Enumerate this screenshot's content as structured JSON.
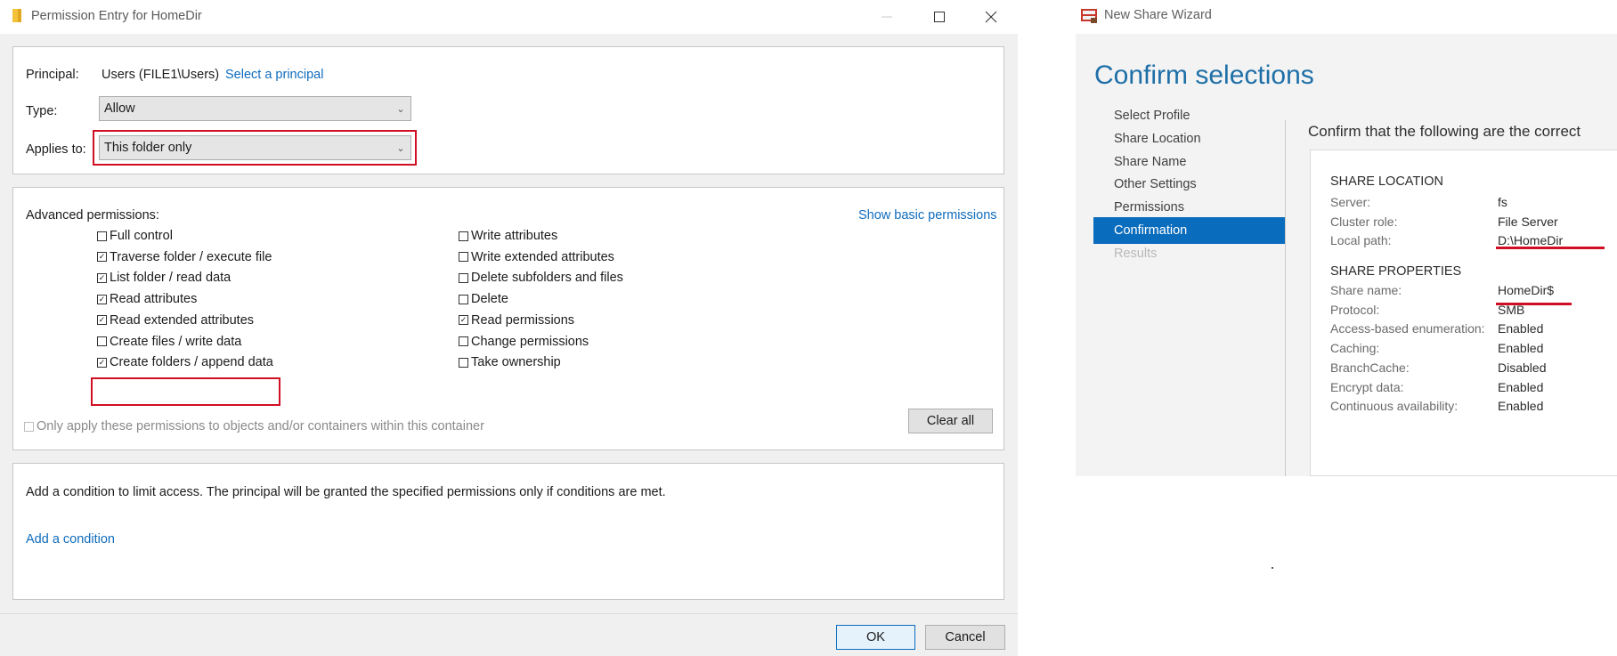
{
  "permission_entry": {
    "title": "Permission Entry for HomeDir",
    "principal": {
      "label": "Principal:",
      "value": "Users (FILE1\\Users)",
      "link": "Select a principal"
    },
    "type": {
      "label": "Type:",
      "value": "Allow"
    },
    "applies_to": {
      "label": "Applies to:",
      "value": "This folder only"
    },
    "advanced_label": "Advanced permissions:",
    "show_basic_link": "Show basic permissions",
    "permissions_left": [
      {
        "label": "Full control",
        "checked": false
      },
      {
        "label": "Traverse folder / execute file",
        "checked": true
      },
      {
        "label": "List folder / read data",
        "checked": true
      },
      {
        "label": "Read attributes",
        "checked": true
      },
      {
        "label": "Read extended attributes",
        "checked": true
      },
      {
        "label": "Create files / write data",
        "checked": false
      },
      {
        "label": "Create folders / append data",
        "checked": true
      }
    ],
    "permissions_right": [
      {
        "label": "Write attributes",
        "checked": false
      },
      {
        "label": "Write extended attributes",
        "checked": false
      },
      {
        "label": "Delete subfolders and files",
        "checked": false
      },
      {
        "label": "Delete",
        "checked": false
      },
      {
        "label": "Read permissions",
        "checked": true
      },
      {
        "label": "Change permissions",
        "checked": false
      },
      {
        "label": "Take ownership",
        "checked": false
      }
    ],
    "only_apply_label": "Only apply these permissions to objects and/or containers within this container",
    "clear_all": "Clear all",
    "condition_text": "Add a condition to limit access. The principal will be granted the specified permissions only if conditions are met.",
    "add_condition": "Add a condition",
    "ok": "OK",
    "cancel": "Cancel"
  },
  "wizard": {
    "title": "New Share Wizard",
    "heading": "Confirm selections",
    "instruction": "Confirm that the following are the correct",
    "nav": [
      {
        "label": "Select Profile",
        "state": "normal"
      },
      {
        "label": "Share Location",
        "state": "normal"
      },
      {
        "label": "Share Name",
        "state": "normal"
      },
      {
        "label": "Other Settings",
        "state": "normal"
      },
      {
        "label": "Permissions",
        "state": "normal"
      },
      {
        "label": "Confirmation",
        "state": "active"
      },
      {
        "label": "Results",
        "state": "disabled"
      }
    ],
    "share_location": {
      "title": "SHARE LOCATION",
      "rows": [
        {
          "label": "Server:",
          "value": "fs"
        },
        {
          "label": "Cluster role:",
          "value": "File Server"
        },
        {
          "label": "Local path:",
          "value": "D:\\HomeDir"
        }
      ]
    },
    "share_properties": {
      "title": "SHARE PROPERTIES",
      "rows": [
        {
          "label": "Share name:",
          "value": "HomeDir$"
        },
        {
          "label": "Protocol:",
          "value": "SMB"
        },
        {
          "label": "Access-based enumeration:",
          "value": "Enabled"
        },
        {
          "label": "Caching:",
          "value": "Enabled"
        },
        {
          "label": "BranchCache:",
          "value": "Disabled"
        },
        {
          "label": "Encrypt data:",
          "value": "Enabled"
        },
        {
          "label": "Continuous availability:",
          "value": "Enabled"
        }
      ]
    }
  },
  "colors": {
    "link": "#0f6cbd",
    "highlight": "#d10f24",
    "wizard_accent": "#0a6cbd",
    "heading": "#1e6fa8"
  }
}
